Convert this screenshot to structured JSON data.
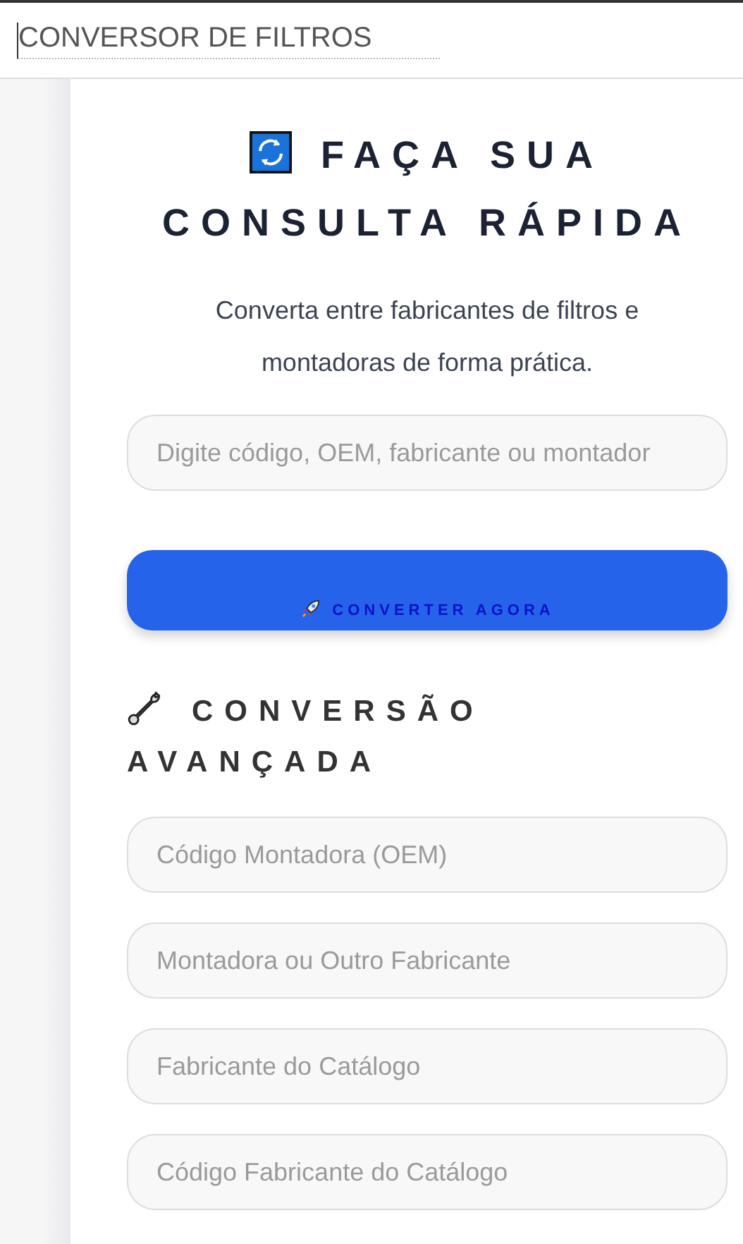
{
  "header": {
    "value": "CONVERSOR DE FILTROS"
  },
  "hero": {
    "title_lines": [
      "FAÇA SUA",
      "CONSULTA RÁPIDA"
    ],
    "subtitle": "Converta entre fabricantes de filtros e montadoras de forma prática."
  },
  "quick_search": {
    "placeholder": "Digite código, OEM, fabricante ou montador"
  },
  "convert_button": {
    "label": "CONVERTER AGORA"
  },
  "advanced": {
    "title_lines": [
      "CONVERSÃO",
      "AVANÇADA"
    ],
    "fields": [
      {
        "placeholder": "Código Montadora (OEM)"
      },
      {
        "placeholder": "Montadora ou Outro Fabricante"
      },
      {
        "placeholder": "Fabricante do Catálogo"
      },
      {
        "placeholder": "Código Fabricante do Catálogo"
      }
    ]
  }
}
